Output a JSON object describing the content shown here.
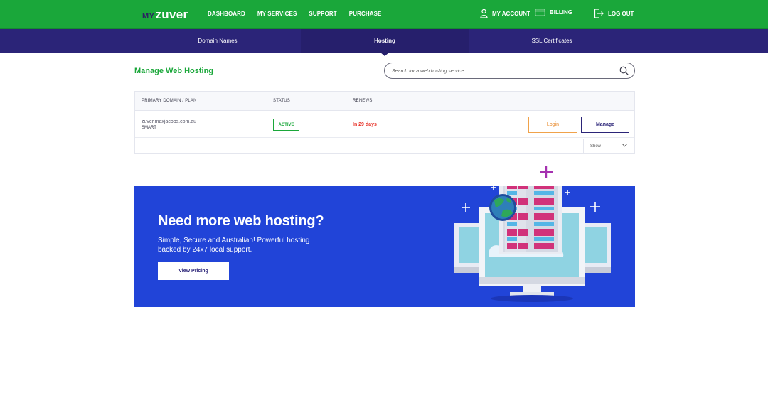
{
  "logo": {
    "prefix": "MY",
    "brand": "zuver"
  },
  "main_nav": {
    "dashboard": "DASHBOARD",
    "my_services": "MY SERVICES",
    "support": "SUPPORT",
    "purchase": "PURCHASE"
  },
  "right_nav": {
    "my_account": "MY ACCOUNT",
    "billing": "BILLING",
    "log_out": "LOG OUT"
  },
  "sub_nav": {
    "domain_names": "Domain Names",
    "hosting": "Hosting",
    "ssl_certificates": "SSL Certificates",
    "active_tab": "Hosting"
  },
  "page": {
    "title": "Manage Web Hosting"
  },
  "search": {
    "placeholder": "Search for a web hosting service"
  },
  "table": {
    "headers": {
      "domain": "PRIMARY DOMAIN / PLAN",
      "status": "STATUS",
      "renews": "RENEWS"
    },
    "rows": [
      {
        "domain": "zuver.maxjacobs.com.au",
        "plan": "SMART",
        "status": "ACTIVE",
        "renews": "In 29 days",
        "login_label": "Login",
        "manage_label": "Manage"
      }
    ],
    "show_label": "Show"
  },
  "promo": {
    "title": "Need more web hosting?",
    "subtitle": "Simple, Secure and Australian! Powerful hosting backed by 24x7 local support.",
    "button": "View Pricing"
  },
  "colors": {
    "brand_green": "#1aa73a",
    "nav_purple": "#2b2478",
    "promo_blue": "#2144d8",
    "alert_red": "#e8352b",
    "login_orange": "#f0a24a"
  }
}
